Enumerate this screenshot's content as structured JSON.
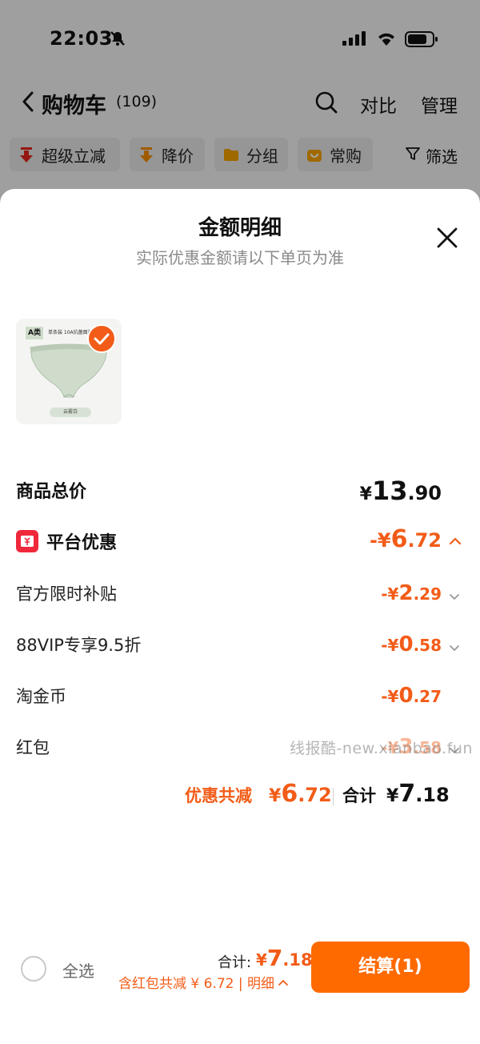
{
  "status_bar": {
    "time": "22:03"
  },
  "header": {
    "title": "购物车",
    "count": "(109)",
    "compare": "对比",
    "manage": "管理"
  },
  "filters": {
    "chips": [
      {
        "label": "超级立减",
        "icon": "red-down-arrow-icon"
      },
      {
        "label": "降价",
        "icon": "orange-down-arrow-icon"
      },
      {
        "label": "分组",
        "icon": "folder-icon"
      },
      {
        "label": "常购",
        "icon": "bag-icon"
      }
    ],
    "filter_label": "筛选"
  },
  "sheet": {
    "title": "金额明细",
    "subtitle": "实际优惠金额请以下单页为准",
    "product": {
      "tag": "A类",
      "tag_text": "单条装  10A抗菌面裆",
      "caption": "云雾白"
    },
    "total_price": {
      "label": "商品总价",
      "yen": "¥",
      "int": "13",
      "dec": ".90"
    },
    "platform_discount": {
      "label": "平台优惠",
      "sign": "-¥",
      "int": "6",
      "dec": ".72"
    },
    "rows": [
      {
        "label": "官方限时补贴",
        "sign": "-¥",
        "int": "2",
        "dec": ".29",
        "has_chevron": true
      },
      {
        "label": "88VIP专享9.5折",
        "sign": "-¥",
        "int": "0",
        "dec": ".58",
        "has_chevron": true
      },
      {
        "label": "淘金币",
        "sign": "-¥",
        "int": "0",
        "dec": ".27",
        "has_chevron": false
      },
      {
        "label": "红包",
        "sign": "-¥",
        "int": "3",
        "dec": ".58",
        "has_chevron": true
      }
    ],
    "watermark": "线报酷-new.xianbao.fun",
    "summary": {
      "discount_label": "优惠共减",
      "discount_yen": "¥",
      "discount_int": "6",
      "discount_dec": ".72",
      "total_label": "合计",
      "total_yen": "¥",
      "total_int": "7",
      "total_dec": ".18"
    }
  },
  "bottom_bar": {
    "select_all": "全选",
    "total_label": "合计:",
    "total_yen": "¥",
    "total_int": "7",
    "total_dec": ".18",
    "subtext": "含红包共减 ¥ 6.72 | 明细",
    "checkout": "结算(1)"
  },
  "colors": {
    "accent": "#f25c18",
    "checkout_bg": "#ff6a00",
    "platform_badge": "#f0283c"
  }
}
